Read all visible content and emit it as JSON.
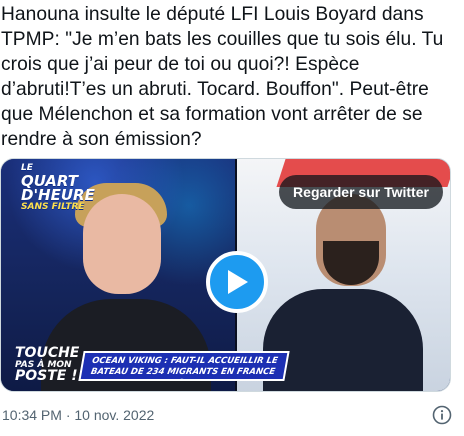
{
  "tweet": {
    "text": "Hanouna insulte le député LFI Louis Boyard dans TPMP: \"Je m’en bats les couilles que tu sois élu. Tu crois que j’ai peur de toi ou quoi?! Espèce d’abruti!T’es un abruti. Tocard. Bouffon\". Peut-être que Mélenchon et sa formation vont arrêter de se rendre à son émission?",
    "timestamp": "10:34 PM · 10 nov. 2022"
  },
  "media": {
    "watch_label": "Regarder sur Twitter",
    "show_logo": {
      "line1": "LE",
      "line2": "QUART D'HEURE",
      "line3": "SANS FILTRE"
    },
    "corner_logo": {
      "line1": "TOUCHE",
      "line2": "PAS À MON",
      "line3": "POSTE !"
    },
    "banner_text": "OCEAN VIKING : FAUT-IL ACCUEILLIR LE BATEAU DE 234 MIGRANTS EN FRANCE ?",
    "play_icon": "play-icon"
  },
  "icons": {
    "info": "info-icon"
  },
  "colors": {
    "accent": "#1d9bf0",
    "text": "#0f1419",
    "muted": "#536471",
    "border": "#cfd9de"
  }
}
